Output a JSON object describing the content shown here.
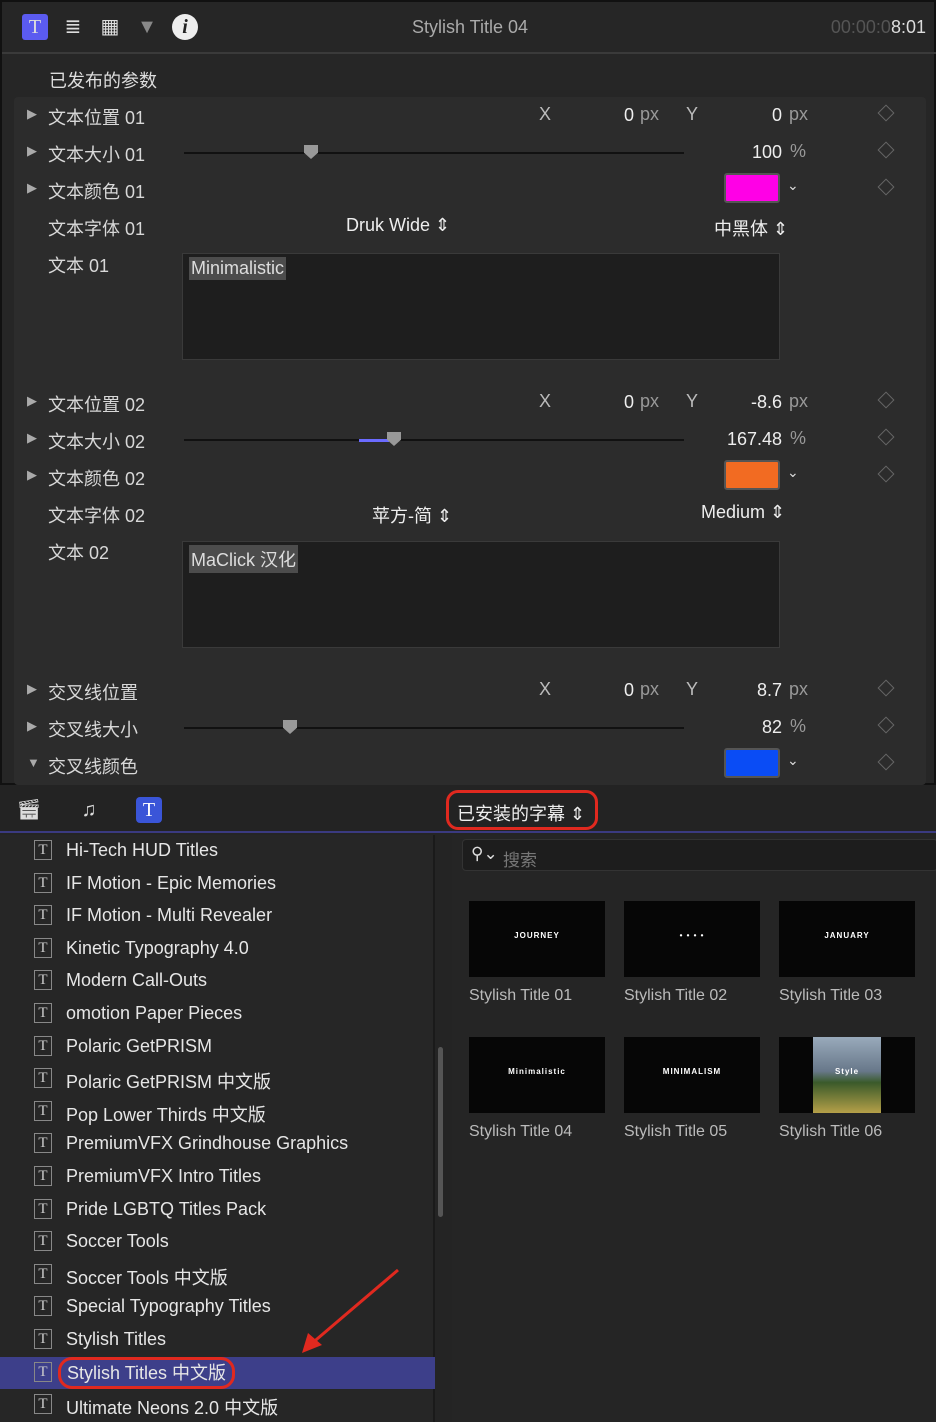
{
  "header": {
    "title": "Stylish Title 04",
    "timecode_dim": "00:00:0",
    "timecode": "8:01",
    "icons": [
      "text-icon",
      "lines-icon",
      "film-icon",
      "triangle-icon",
      "info-icon"
    ]
  },
  "published_label": "已发布的参数",
  "rows": {
    "pos1": {
      "label": "文本位置 01",
      "x": "0",
      "y": "0",
      "unit": "px"
    },
    "size1": {
      "label": "文本大小 01",
      "value": "100",
      "unit": "%",
      "slider": 0.25
    },
    "color1": {
      "label": "文本颜色 01",
      "color": "#ff00e6"
    },
    "font1": {
      "label": "文本字体 01",
      "family": "Druk Wide",
      "weight": "中黑体"
    },
    "text1": {
      "label": "文本 01",
      "value": "Minimalistic"
    },
    "pos2": {
      "label": "文本位置 02",
      "x": "0",
      "y": "-8.6",
      "unit": "px"
    },
    "size2": {
      "label": "文本大小 02",
      "value": "167.48",
      "unit": "%",
      "slider": 0.42
    },
    "color2": {
      "label": "文本颜色 02",
      "color": "#f26b22"
    },
    "font2": {
      "label": "文本字体 02",
      "family": "苹方-简",
      "weight": "Medium"
    },
    "text2": {
      "label": "文本 02",
      "value": "MaClick 汉化"
    },
    "pos3": {
      "label": "交叉线位置",
      "x": "0",
      "y": "8.7",
      "unit": "px"
    },
    "size3": {
      "label": "交叉线大小",
      "value": "82",
      "unit": "%",
      "slider": 0.21
    },
    "color3": {
      "label": "交叉线颜色",
      "color": "#0a4cf5"
    }
  },
  "xy": {
    "x": "X",
    "y": "Y",
    "pct": "%"
  },
  "browser": {
    "category": "已安装的字幕",
    "search_placeholder": "搜索",
    "list": [
      "Hi-Tech HUD Titles",
      "IF Motion - Epic Memories",
      "IF Motion - Multi Revealer",
      "Kinetic Typography 4.0",
      "Modern Call-Outs",
      "omotion Paper Pieces",
      "Polaric GetPRISM",
      "Polaric GetPRISM 中文版",
      "Pop Lower Thirds 中文版",
      "PremiumVFX Grindhouse Graphics",
      "PremiumVFX Intro Titles",
      "Pride LGBTQ Titles Pack",
      "Soccer Tools",
      "Soccer Tools 中文版",
      "Special Typography Titles",
      "Stylish Titles",
      "Stylish Titles 中文版",
      "Ultimate Neons 2.0 中文版"
    ],
    "selected": 16,
    "thumbs": [
      {
        "name": "Stylish Title 01",
        "preview": "JOURNEY"
      },
      {
        "name": "Stylish Title 02",
        "preview": "• • • •"
      },
      {
        "name": "Stylish Title 03",
        "preview": "JANUARY"
      },
      {
        "name": "Stylish Title 04",
        "preview": "Minimalistic"
      },
      {
        "name": "Stylish Title 05",
        "preview": "MINIMALISM"
      },
      {
        "name": "Stylish Title 06",
        "preview": "Style"
      }
    ]
  },
  "accent": "#5b5bf0",
  "highlight": "#e0291f"
}
